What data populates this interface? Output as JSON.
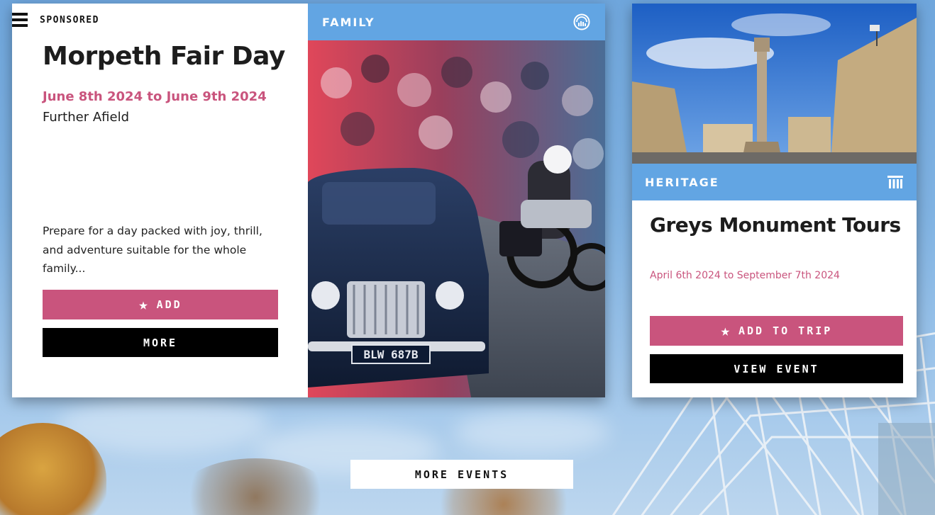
{
  "featured_event": {
    "sponsored_label": "SPONSORED",
    "title": "Morpeth Fair Day",
    "dates": "June 8th 2024 to June 9th 2024",
    "location": "Further Afield",
    "description": "Prepare for a day packed with joy, thrill, and adventure suitable for the whole family...",
    "category": "FAMILY",
    "category_icon": "family-icon",
    "add_label": "ADD",
    "more_label": "MORE",
    "photo": {
      "name": "classic-car-parade-photo",
      "plate_text": "BLW 687B"
    }
  },
  "side_event": {
    "category": "HERITAGE",
    "category_icon": "column-icon",
    "title": "Greys Monument Tours",
    "dates": "April 6th 2024 to September 7th 2024",
    "add_label": "ADD TO TRIP",
    "view_label": "VIEW EVENT",
    "photo": {
      "name": "greys-monument-photo"
    }
  },
  "footer": {
    "more_events_label": "MORE EVENTS"
  },
  "colors": {
    "accent_pink": "#c9547d",
    "category_blue": "#62a5e3",
    "button_black": "#000000",
    "sky_blue": "#6fa6dc"
  }
}
